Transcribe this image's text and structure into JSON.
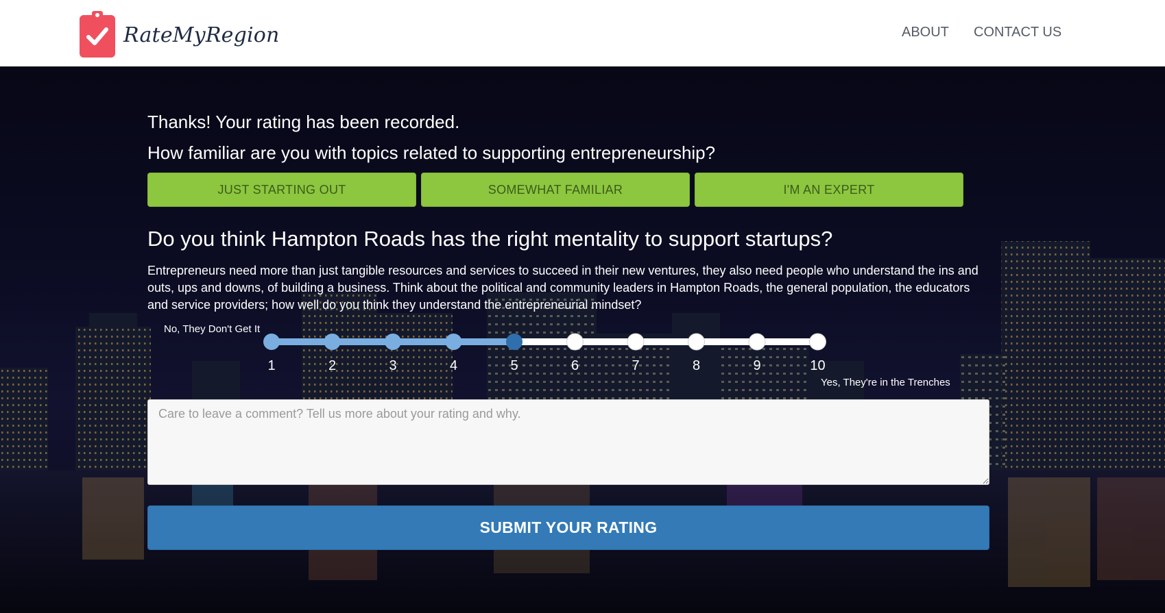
{
  "header": {
    "brand": "RateMyRegion",
    "nav": {
      "about": "ABOUT",
      "contact": "CONTACT US"
    }
  },
  "main": {
    "thanks": "Thanks! Your rating has been recorded.",
    "familiarity_question": "How familiar are you with topics related to supporting entrepreneurship?",
    "familiarity_options": [
      "JUST STARTING OUT",
      "SOMEWHAT FAMILIAR",
      "I'M AN EXPERT"
    ],
    "question": "Do you think Hampton Roads has the right mentality to support startups?",
    "description": "Entrepreneurs need more than just tangible resources and services to succeed in their new ventures, they also need people who understand the ins and outs, ups and downs, of building a business. Think about the political and community leaders in Hampton Roads, the general population, the educators and service providers; how well do you think they understand the entrepreneurial mindset?",
    "scale": {
      "low_label": "No, They Don't Get It",
      "high_label": "Yes, They're in the Trenches",
      "ticks": [
        "1",
        "2",
        "3",
        "4",
        "5",
        "6",
        "7",
        "8",
        "9",
        "10"
      ],
      "selected": 5
    },
    "comment_placeholder": "Care to leave a comment? Tell us more about your rating and why.",
    "submit_label": "SUBMIT YOUR RATING"
  },
  "colors": {
    "logo": "#f0505e",
    "brand_text": "#1f2a44",
    "familiarity_button": "#8dc63f",
    "familiarity_text": "#3a5c1a",
    "slider_fill": "#7aaee0",
    "slider_selected": "#2f6fae",
    "slider_empty": "#ffffff",
    "submit": "#337ab7"
  }
}
